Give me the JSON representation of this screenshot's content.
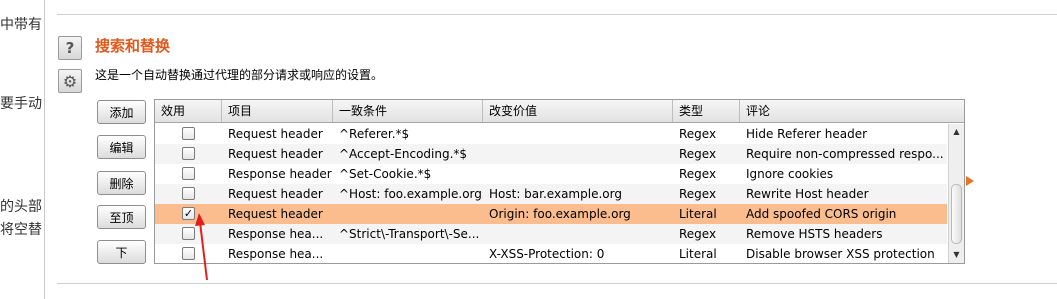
{
  "left_fragments": [
    "中带有",
    "要手动",
    "的头部",
    "将空替"
  ],
  "icons": {
    "help": "?",
    "settings": "⚙"
  },
  "section": {
    "title": "搜索和替换",
    "description": "这是一个自动替换通过代理的部分请求或响应的设置。"
  },
  "buttons": {
    "add": "添加",
    "edit": "编辑",
    "remove": "删除",
    "top": "至顶",
    "down": "下"
  },
  "table": {
    "columns": [
      "效用",
      "项目",
      "一致条件",
      "改变价值",
      "类型",
      "评论"
    ],
    "rows": [
      {
        "enabled": false,
        "item": "Request header",
        "match": "^Referer.*$",
        "replace": "",
        "type": "Regex",
        "comment": "Hide Referer header"
      },
      {
        "enabled": false,
        "item": "Request header",
        "match": "^Accept-Encoding.*$",
        "replace": "",
        "type": "Regex",
        "comment": "Require non-compressed respo..."
      },
      {
        "enabled": false,
        "item": "Response header",
        "match": "^Set-Cookie.*$",
        "replace": "",
        "type": "Regex",
        "comment": "Ignore cookies"
      },
      {
        "enabled": false,
        "item": "Request header",
        "match": "^Host: foo.example.org$",
        "replace": "Host: bar.example.org",
        "type": "Regex",
        "comment": "Rewrite Host header"
      },
      {
        "enabled": true,
        "item": "Request header",
        "match": "",
        "replace": "Origin: foo.example.org",
        "type": "Literal",
        "comment": "Add spoofed CORS origin"
      },
      {
        "enabled": false,
        "item": "Response hea...",
        "match": "^Strict\\-Transport\\-Se...",
        "replace": "",
        "type": "Regex",
        "comment": "Remove HSTS headers"
      },
      {
        "enabled": false,
        "item": "Response hea...",
        "match": "",
        "replace": "X-XSS-Protection: 0",
        "type": "Literal",
        "comment": "Disable browser XSS protection"
      }
    ],
    "selected_row_index": 4
  },
  "colors": {
    "title": "#e05a1e",
    "selected_row": "#fbbd8e",
    "annotation_arrow": "#e02020"
  }
}
